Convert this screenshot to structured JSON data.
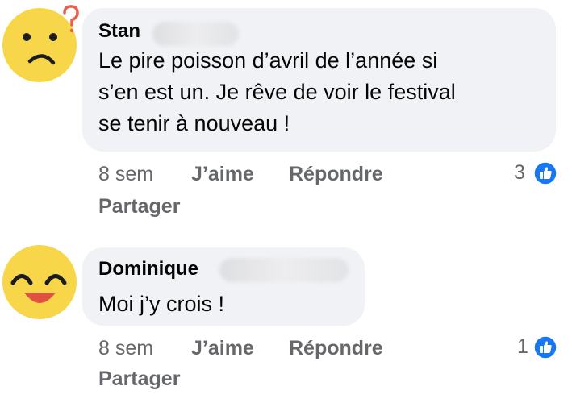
{
  "comments": [
    {
      "author": "Stan",
      "text_lines": [
        "Le pire poisson d’avril de l’année si",
        "s’en est un. Je rêve de voir le festival",
        "se tenir à nouveau !"
      ],
      "time": "8 sem",
      "like_label": "J’aime",
      "reply_label": "Répondre",
      "share_label": "Partager",
      "reaction_count": "3",
      "reaction_icon": "thumbs-up-icon",
      "avatar_icon": "confused-face-emoji-icon"
    },
    {
      "author": "Dominique",
      "text_lines": [
        "Moi j’y crois !"
      ],
      "time": "8 sem",
      "like_label": "J’aime",
      "reply_label": "Répondre",
      "share_label": "Partager",
      "reaction_count": "1",
      "reaction_icon": "thumbs-up-icon",
      "avatar_icon": "smiling-face-emoji-icon"
    }
  ],
  "colors": {
    "bubble_bg": "#f0f2f5",
    "meta_text": "#65676b",
    "like_blue": "#1877f2",
    "emoji_yellow": "#f7d64a"
  }
}
